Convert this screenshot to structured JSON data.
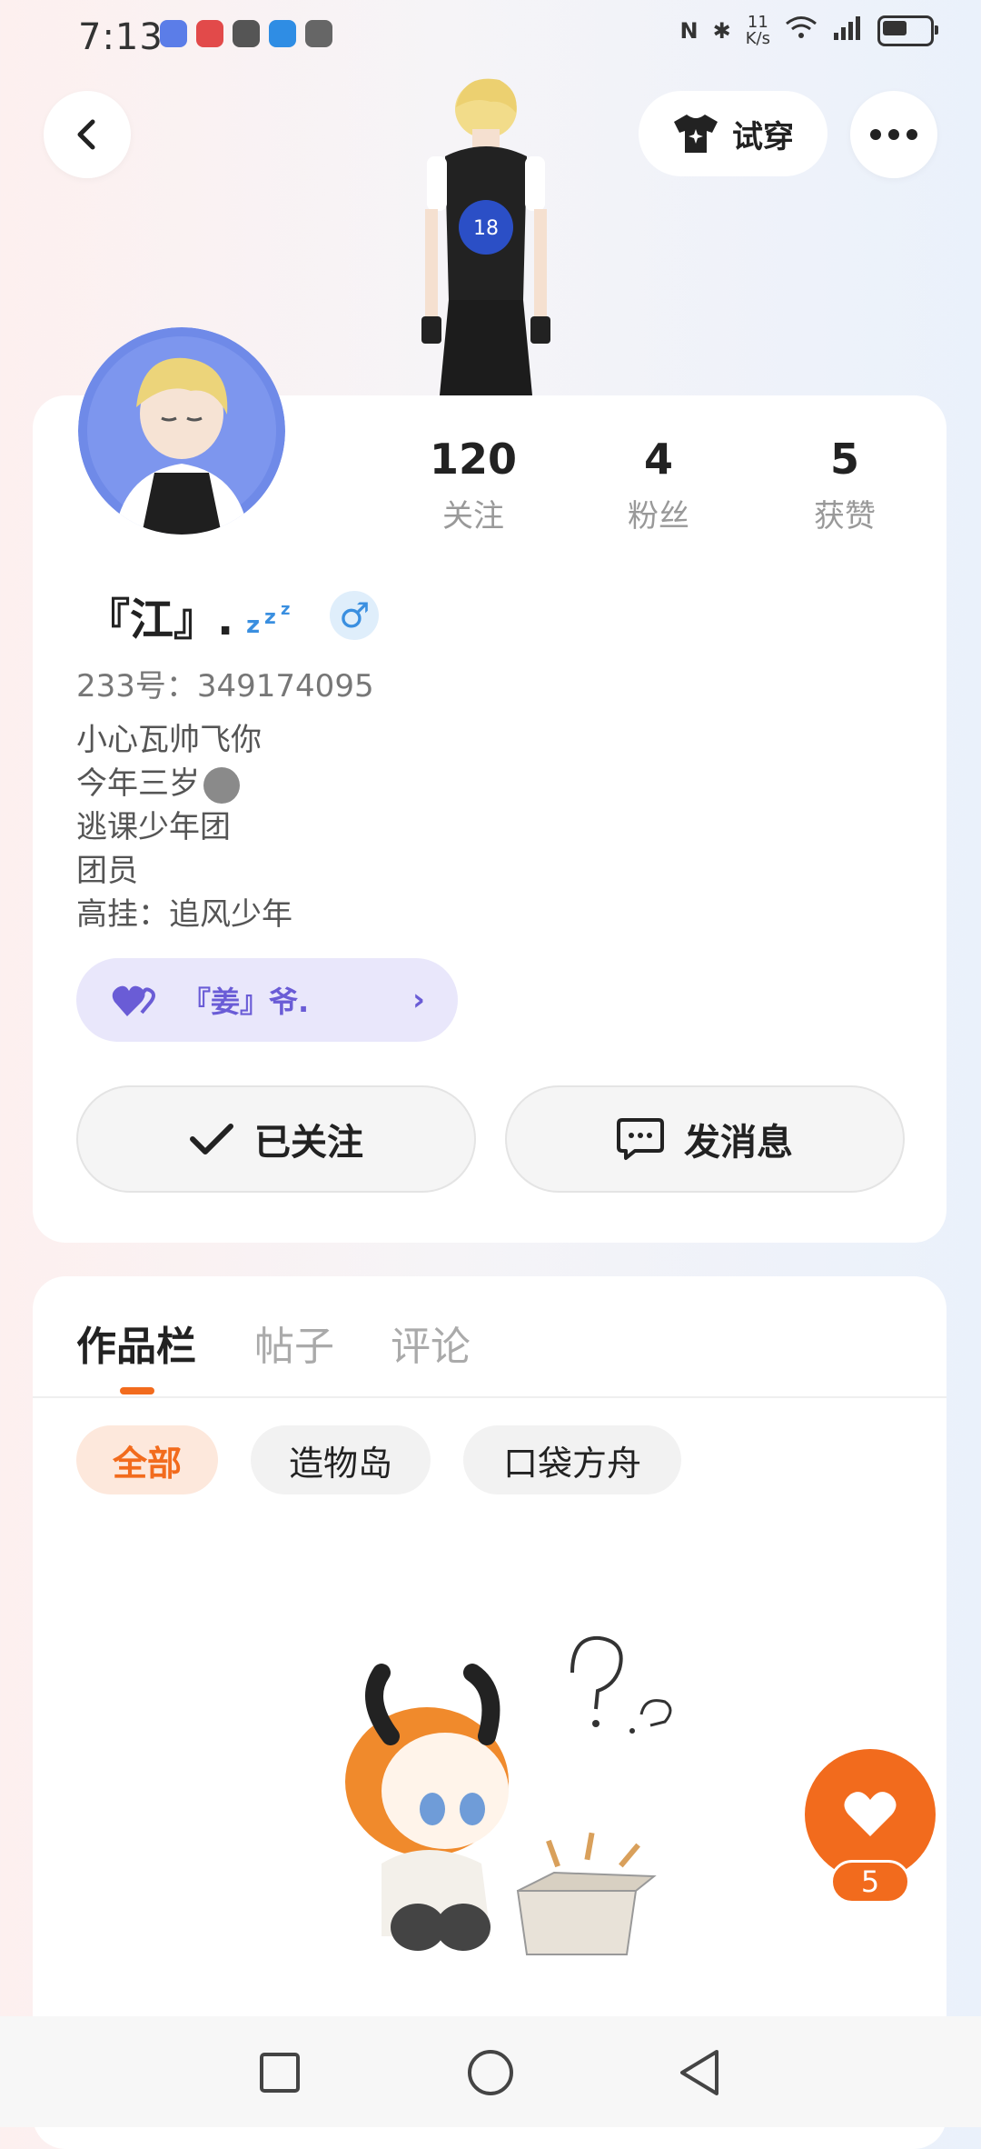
{
  "status_bar": {
    "time": "7:13",
    "net_speed_value": "11",
    "net_speed_unit": "K/s",
    "network": "4G"
  },
  "top_nav": {
    "back_icon": "chevron-left-icon",
    "try_on_label": "试穿",
    "more_icon": "more-dots-icon"
  },
  "stats": [
    {
      "value": "120",
      "label": "关注"
    },
    {
      "value": "4",
      "label": "粉丝"
    },
    {
      "value": "5",
      "label": "获赞"
    }
  ],
  "profile": {
    "username": "『江』.",
    "gender_symbol": "♂",
    "uid": "233号：349174095",
    "bio_lines": [
      "小心瓦帅飞你",
      "今年三岁",
      "逃课少年团",
      "团员",
      "高挂：追风少年"
    ],
    "cp_name": "『姜』爷."
  },
  "actions": {
    "follow_label": "已关注",
    "message_label": "发消息"
  },
  "tabs": [
    {
      "label": "作品栏",
      "active": true
    },
    {
      "label": "帖子",
      "active": false
    },
    {
      "label": "评论",
      "active": false
    }
  ],
  "chips": [
    {
      "label": "全部",
      "active": true
    },
    {
      "label": "造物岛",
      "active": false
    },
    {
      "label": "口袋方舟",
      "active": false
    }
  ],
  "like_button": {
    "count": "5"
  },
  "colors": {
    "accent": "#f26b1d",
    "cp_purple": "#6a5cd6",
    "gender_blue": "#3a8fe0"
  }
}
